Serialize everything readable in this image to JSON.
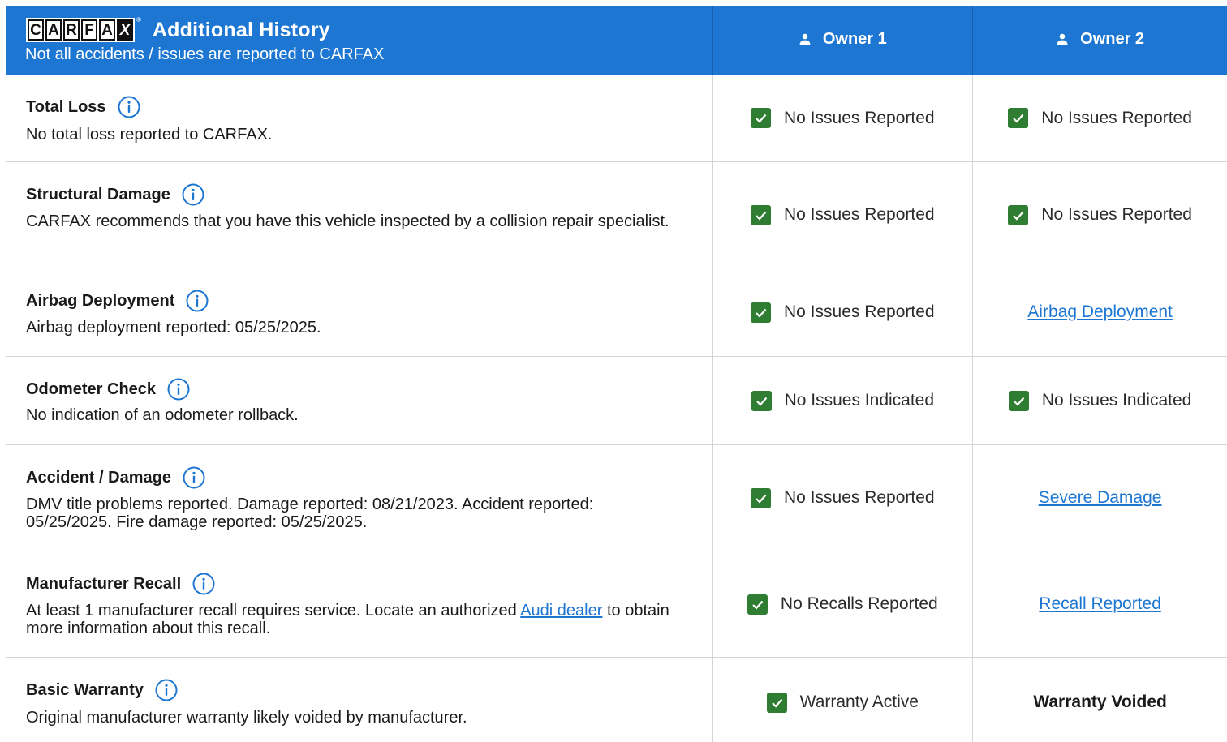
{
  "header": {
    "logo_letters": [
      "C",
      "A",
      "R",
      "F",
      "A",
      "X"
    ],
    "logo_reg": "®",
    "title": "Additional History",
    "subtitle": "Not all accidents / issues are reported to CARFAX",
    "owners": [
      "Owner 1",
      "Owner 2"
    ]
  },
  "colors": {
    "header_blue": "#1d76d2",
    "check_green": "#2e7d32",
    "link_blue": "#1d76d2"
  },
  "rows": [
    {
      "title": "Total Loss",
      "description": "No total loss reported to CARFAX.",
      "owner1": "No Issues Reported",
      "owner2": "No Issues Reported"
    },
    {
      "title": "Structural Damage",
      "description": "CARFAX recommends that you have this vehicle inspected by a collision repair specialist.",
      "owner1": "No Issues Reported",
      "owner2": "No Issues Reported"
    },
    {
      "title": "Airbag Deployment",
      "description": "Airbag deployment reported: 05/25/2025.",
      "owner1": "No Issues Reported",
      "owner2": "Airbag Deployment"
    },
    {
      "title": "Odometer Check",
      "description": "No indication of an odometer rollback.",
      "owner1": "No Issues Indicated",
      "owner2": "No Issues Indicated"
    },
    {
      "title": "Accident / Damage",
      "description": "DMV title problems reported. Damage reported: 08/21/2023. Accident reported: 05/25/2025. Fire damage reported: 05/25/2025.",
      "owner1": "No Issues Reported",
      "owner2": "Severe Damage"
    },
    {
      "title": "Manufacturer Recall",
      "description_before": "At least 1 manufacturer recall requires service. Locate an authorized ",
      "description_link": "Audi dealer",
      "description_after": " to obtain more information about this recall.",
      "owner1": "No Recalls Reported",
      "owner2": "Recall Reported"
    },
    {
      "title": "Basic Warranty",
      "description": "Original manufacturer warranty likely voided by manufacturer.",
      "owner1": "Warranty Active",
      "owner2": "Warranty Voided"
    }
  ],
  "icons": {
    "info": "info-icon",
    "owner": "person-icon",
    "status": "check-icon"
  }
}
